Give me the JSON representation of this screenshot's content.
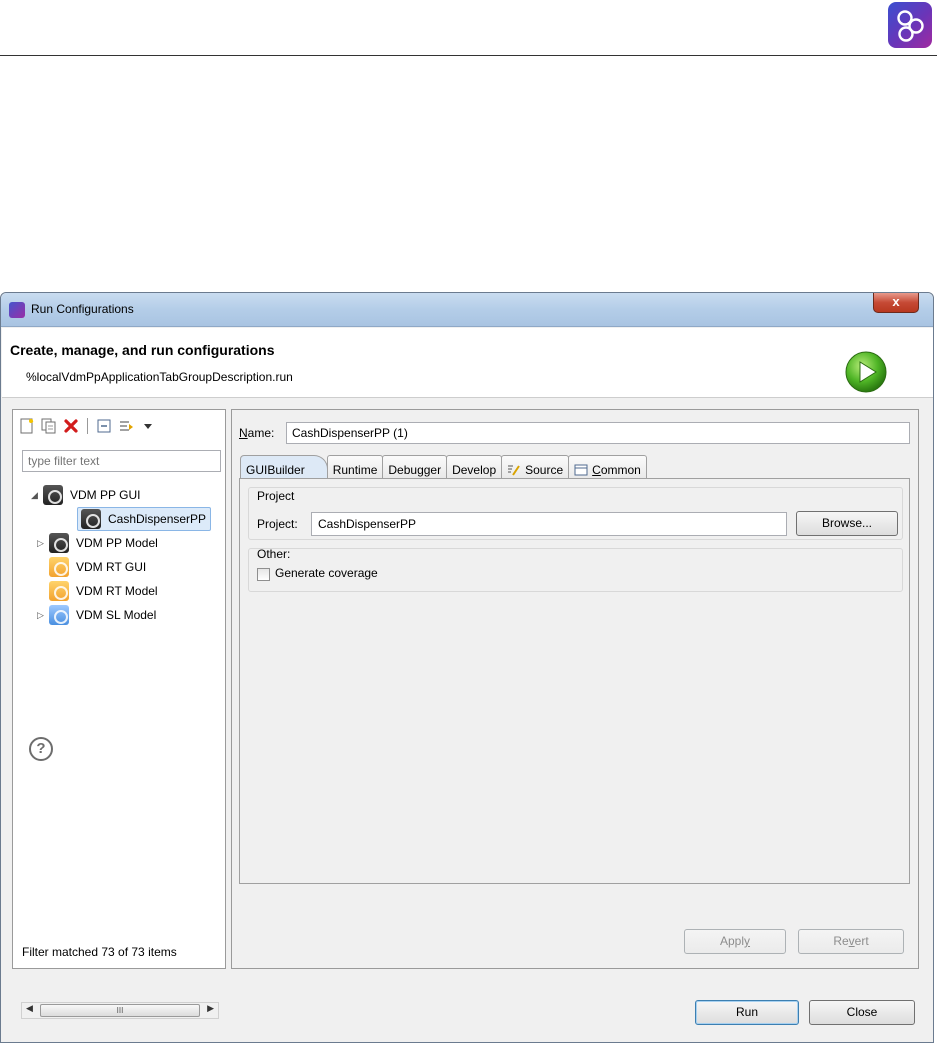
{
  "window": {
    "title": "Run Configurations",
    "close_glyph": "x"
  },
  "header": {
    "title": "Create, manage, and run configurations",
    "description": "%localVdmPpApplicationTabGroupDescription.run"
  },
  "left": {
    "filter_placeholder": "type filter text",
    "tree": [
      {
        "label": "VDM PP GUI",
        "expanded": true
      },
      {
        "label": "CashDispenserPP",
        "selected": true
      },
      {
        "label": "VDM PP Model"
      },
      {
        "label": "VDM RT GUI"
      },
      {
        "label": "VDM RT Model"
      },
      {
        "label": "VDM SL Model"
      }
    ],
    "scroll_thumb": "III",
    "status": "Filter matched 73 of 73 items"
  },
  "config": {
    "name_label_first": "N",
    "name_label_rest": "ame:",
    "name_value": "CashDispenserPP (1)",
    "tabs": [
      "GUIBuilder",
      "Runtime",
      "Debugger",
      "Develop",
      "Source",
      "Common"
    ],
    "common_tab_first": "C",
    "common_tab_rest": "ommon",
    "project_group": "Project",
    "project_label": "Project:",
    "project_value": "CashDispenserPP",
    "browse": "Browse...",
    "other_group": "Other:",
    "generate_coverage": "Generate coverage",
    "apply_prefix": "Appl",
    "apply_u": "y",
    "revert_prefix": "Re",
    "revert_u": "v",
    "revert_suffix": "ert"
  },
  "footer": {
    "help": "?",
    "run": "Run",
    "close": "Close"
  }
}
